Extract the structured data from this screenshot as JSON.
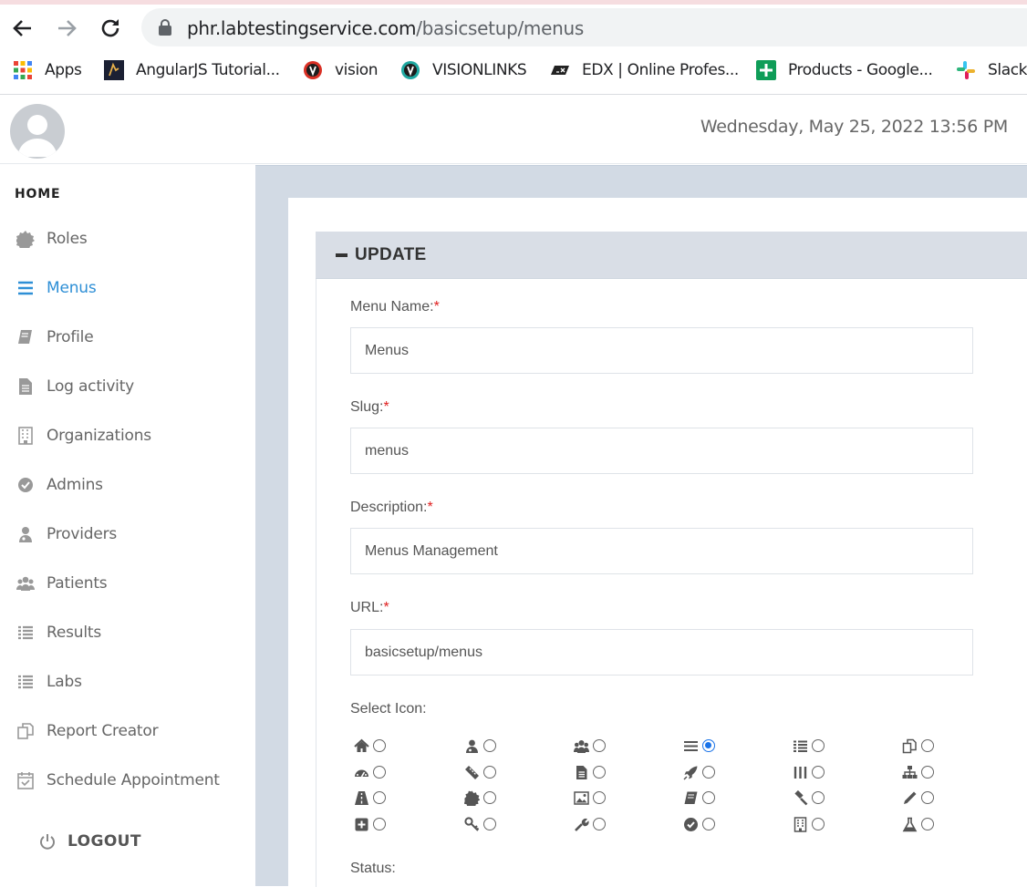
{
  "browser": {
    "url_domain": "phr.labtestingservice.com",
    "url_path": "/basicsetup/menus",
    "bookmarks": [
      {
        "label": "Apps",
        "icon": "apps-grid-icon"
      },
      {
        "label": "AngularJS Tutorial...",
        "icon": "angularjs-icon"
      },
      {
        "label": "vision",
        "icon": "vision-icon"
      },
      {
        "label": "VISIONLINKS",
        "icon": "visionlinks-icon"
      },
      {
        "label": "EDX | Online Profes...",
        "icon": "edx-icon"
      },
      {
        "label": "Products - Google...",
        "icon": "google-sheets-icon"
      },
      {
        "label": "Slack",
        "icon": "slack-icon"
      }
    ]
  },
  "header": {
    "datetime": "Wednesday, May 25, 2022 13:56 PM"
  },
  "sidebar": {
    "home": "HOME",
    "items": [
      {
        "label": "Roles",
        "icon": "cog-icon"
      },
      {
        "label": "Menus",
        "icon": "bars-icon",
        "active": true
      },
      {
        "label": "Profile",
        "icon": "book-icon"
      },
      {
        "label": "Log activity",
        "icon": "file-text-icon"
      },
      {
        "label": "Organizations",
        "icon": "building-icon"
      },
      {
        "label": "Admins",
        "icon": "check-circle-icon"
      },
      {
        "label": "Providers",
        "icon": "user-md-icon"
      },
      {
        "label": "Patients",
        "icon": "users-icon"
      },
      {
        "label": "Results",
        "icon": "list-icon"
      },
      {
        "label": "Labs",
        "icon": "list-icon"
      },
      {
        "label": "Report Creator",
        "icon": "copy-icon"
      },
      {
        "label": "Schedule Appointment",
        "icon": "calendar-check-icon"
      }
    ],
    "logout": "LOGOUT"
  },
  "form": {
    "panel_title": "UPDATE",
    "menu_name_label": "Menu Name:",
    "menu_name_value": "Menus",
    "slug_label": "Slug:",
    "slug_value": "menus",
    "description_label": "Description:",
    "description_value": "Menus Management",
    "url_label": "URL:",
    "url_value": "basicsetup/menus",
    "required_mark": "*",
    "select_icon_label": "Select Icon:",
    "status_label": "Status:",
    "icon_options": [
      [
        "home-icon",
        "user-md-icon",
        "users-icon",
        "bars-icon",
        "list-icon",
        "copy-icon"
      ],
      [
        "dashboard-icon",
        "ticket-icon",
        "file-text-icon",
        "rocket-icon",
        "columns-icon",
        "sitemap-icon"
      ],
      [
        "road-icon",
        "cog-icon",
        "image-icon",
        "book-icon",
        "gavel-icon",
        "pencil-icon"
      ],
      [
        "plus-square-icon",
        "key-icon",
        "wrench-icon",
        "check-circle-icon",
        "building-icon",
        "flask-icon"
      ]
    ],
    "selected_icon": "bars-icon",
    "colors": {
      "active": "#2e8fd6",
      "required": "#e02020",
      "radio": "#1a73e8"
    }
  }
}
